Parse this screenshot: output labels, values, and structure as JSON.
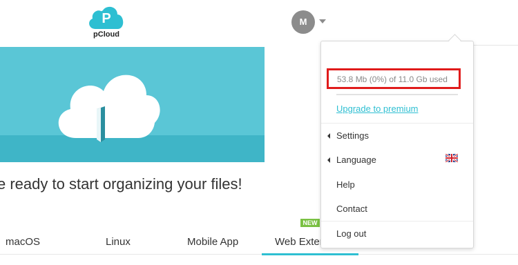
{
  "header": {
    "logo_text": "pCloud",
    "avatar_initial": "M"
  },
  "hero": {
    "headline": "e ready to start organizing your files!"
  },
  "tabs": [
    {
      "label": "macOS"
    },
    {
      "label": "Linux"
    },
    {
      "label": "Mobile App"
    },
    {
      "label": "Web Exter"
    }
  ],
  "new_badge": "NEW",
  "dropdown": {
    "user_partial": "",
    "storage_text": "53.8 Mb (0%) of 11.0 Gb used",
    "storage_percent": 0,
    "upgrade_label": "Upgrade to premium",
    "items": [
      {
        "label": "Settings"
      },
      {
        "label": "Language"
      },
      {
        "label": "Help"
      },
      {
        "label": "Contact"
      },
      {
        "label": "Log out"
      }
    ]
  },
  "colors": {
    "accent": "#2ebfd2",
    "hero_bg": "#5ac6d6",
    "highlight_border": "#e01b1b",
    "new_badge": "#7ac143"
  }
}
